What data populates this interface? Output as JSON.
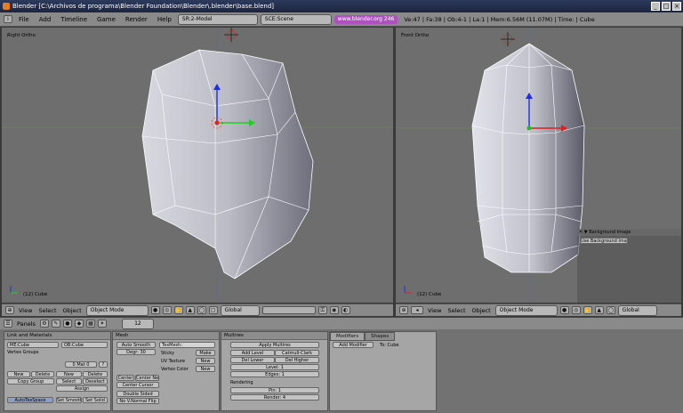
{
  "window": {
    "title": "Blender [C:\\Archivos de programa\\Blender Foundation\\Blender\\.blender\\base.blend]"
  },
  "menu": {
    "items": [
      "File",
      "Add",
      "Timeline",
      "Game",
      "Render",
      "Help"
    ]
  },
  "screen_field": "SR:2-Model",
  "scene_field": "SCE:Scene",
  "website": "www.blender.org 246",
  "stats": "Ve:47 | Fa:38 | Ob:4-1 | La:1 | Mem:6.56M (11.07M) | Time: | Cube",
  "left_view": {
    "label": "Right Ortho",
    "object": "(12) Cube"
  },
  "right_view": {
    "label": "Front Ortho",
    "object": "(12) Cube"
  },
  "bg_image": {
    "title": "Background Image",
    "button": "Use Background Image"
  },
  "view_header": {
    "view": "View",
    "select": "Select",
    "object": "Object",
    "mode": "Object Mode",
    "orientation": "Global"
  },
  "buttons_header": {
    "panels": "Panels",
    "frame": "12"
  },
  "link_panel": {
    "title": "Link and Materials",
    "me": "ME:Cube",
    "ob": "OB:Cube",
    "vertex_groups": "Vertex Groups",
    "mat": "0 Mat 0",
    "mat_q": "?",
    "new": "New",
    "delete": "Delete",
    "copy_group": "Copy Group",
    "new2": "New",
    "delete2": "Delete",
    "select": "Select",
    "deselect": "Deselect",
    "assign": "Assign",
    "autotex": "AutoTexSpace",
    "set_smooth": "Set Smooth",
    "set_solid": "Set Solid"
  },
  "mesh_panel": {
    "title": "Mesh",
    "auto_smooth": "Auto Smooth",
    "degr": "Degr: 30",
    "texmesh": "TexMesh:",
    "sticky": "Sticky",
    "make": "Make",
    "uv_texture": "UV Texture",
    "new_uv": "New",
    "vertex_color": "Vertex Color",
    "new_vc": "New",
    "center": "Center",
    "center_new": "Center New",
    "center_cursor": "Center Cursor",
    "double_sided": "Double Sided",
    "no_vnormal": "No V.Normal Flip"
  },
  "multires_panel": {
    "title": "Multires",
    "apply": "Apply Multires",
    "add_level": "Add Level",
    "catmull": "Catmull-Clark",
    "del_lower": "Del Lower",
    "del_higher": "Del Higher",
    "level": "Level: 1",
    "edges": "Edges: 1",
    "rendering": "Rendering",
    "pin": "Pin: 1",
    "render": "Render: 4"
  },
  "modifiers_panel": {
    "tab_modifiers": "Modifiers",
    "tab_shapes": "Shapes",
    "add_modifier": "Add Modifier",
    "to": "To: Cube"
  }
}
